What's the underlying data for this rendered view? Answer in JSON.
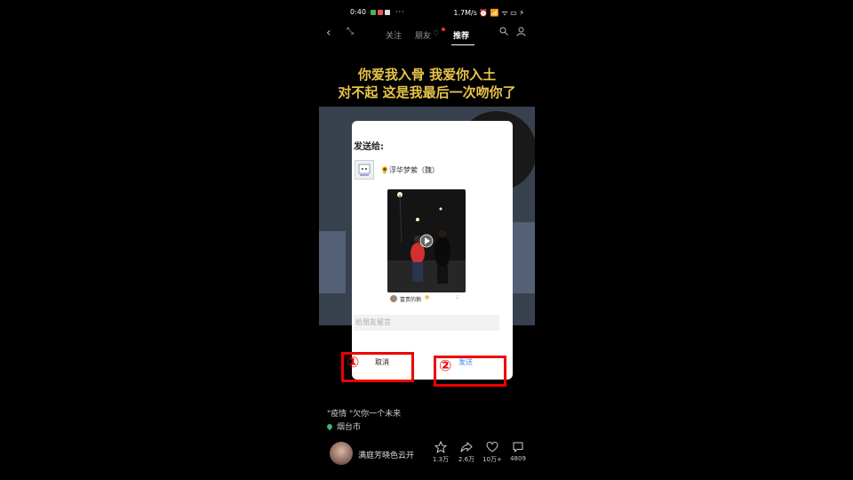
{
  "status_bar": {
    "time": "0:40",
    "dots": "···",
    "right": "1.7M/s ⏰ 📶 ᯤ ▭ ⚡"
  },
  "nav": {
    "tabs": [
      "关注",
      "朋友",
      "推荐"
    ],
    "active_tab": "推荐"
  },
  "caption": {
    "line1": "你爱我入骨 我爱你入土",
    "line2": "对不起 这是我最后一次吻你了"
  },
  "dialog": {
    "title": "发送给:",
    "recipient": "🌻浮华梦萦（魏）",
    "video_footer_user": "富贵的鹅",
    "message_placeholder": "给朋友留言",
    "cancel_label": "取消",
    "send_label": "发送"
  },
  "annotations": {
    "cancel_marker": "①",
    "send_marker": "②"
  },
  "footer": {
    "description": "\"疫情 \"欠你一个未来",
    "location": "烟台市",
    "author": "满庭芳晓色云开",
    "likes": "1.3万",
    "shares": "2.6万",
    "favorites": "10万+",
    "comments": "4809"
  },
  "colors": {
    "caption": "#e8c44a",
    "annotation": "#ee0000",
    "send": "#3a8ee6"
  }
}
